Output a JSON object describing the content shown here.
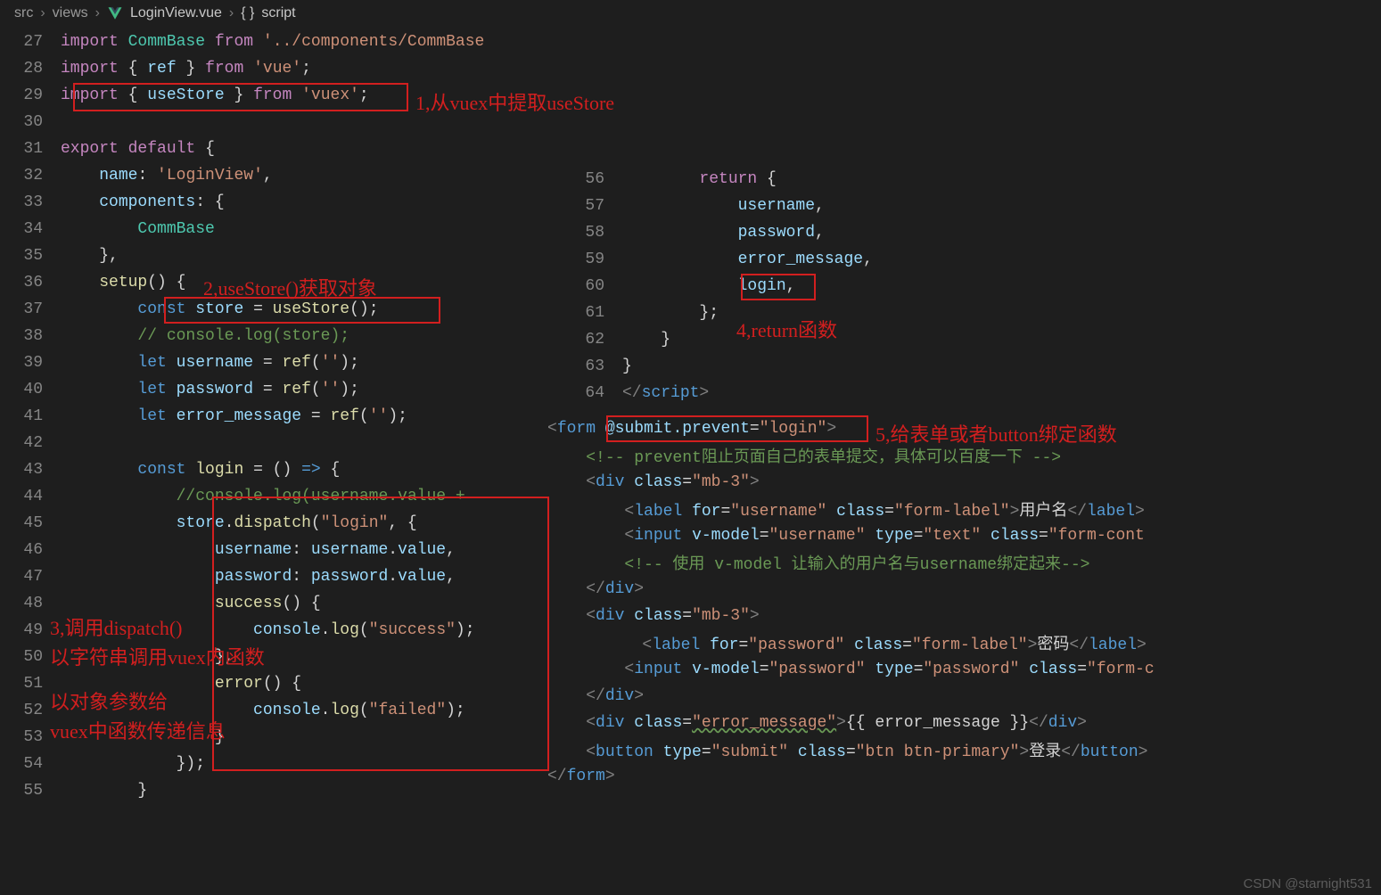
{
  "breadcrumb": {
    "p1": "src",
    "p2": "views",
    "p3": "LoginView.vue",
    "p4": "script"
  },
  "annotations": {
    "a1": "1,从vuex中提取useStore",
    "a2": "2,useStore()获取对象",
    "a3a": "3,调用dispatch()",
    "a3b": "以字符串调用vuex内函数",
    "a3c": "以对象参数给",
    "a3d": "vuex中函数传递信息",
    "a4": "4,return函数",
    "a5": "5,给表单或者button绑定函数"
  },
  "left": {
    "l27": {
      "kw": "import",
      "type": "CommBase",
      "from": "from",
      "str": "'../components/CommBase"
    },
    "l28": {
      "kw": "import",
      "brace1": "{ ",
      "var": "ref",
      "brace2": " }",
      "from": "from",
      "str": "'vue'",
      "semi": ";"
    },
    "l29": {
      "kw": "import",
      "brace1": "{ ",
      "var": "useStore",
      "brace2": " }",
      "from": "from",
      "str": "'vuex'",
      "semi": ";"
    },
    "l31": {
      "kw": "export",
      "kw2": "default",
      "brace": "{"
    },
    "l32": {
      "var": "name",
      "colon": ": ",
      "str": "'LoginView'",
      "comma": ","
    },
    "l33": {
      "var": "components",
      "colon": ": {"
    },
    "l34": {
      "type": "CommBase"
    },
    "l35": {
      "txt": "},"
    },
    "l36": {
      "fn": "setup",
      "paren": "() {"
    },
    "l37": {
      "kw": "const",
      "var": "store",
      "eq": " = ",
      "fn": "useStore",
      "end": "();"
    },
    "l38": {
      "cmt": "// console.log(store);"
    },
    "l39": {
      "kw": "let",
      "var": "username",
      "eq": " = ",
      "fn": "ref",
      "paren": "(",
      "str": "''",
      "end": ");"
    },
    "l40": {
      "kw": "let",
      "var": "password",
      "eq": " = ",
      "fn": "ref",
      "paren": "(",
      "str": "''",
      "end": ");"
    },
    "l41": {
      "kw": "let",
      "var": "error_message",
      "eq": " = ",
      "fn": "ref",
      "paren": "(",
      "str": "''",
      "end": ");"
    },
    "l43": {
      "kw": "const",
      "fn": "login",
      "eq": " = () ",
      "arrow": "=>",
      "brace": " {"
    },
    "l44": {
      "cmt": "//console.log(username.value + "
    },
    "l45": {
      "var": "store",
      "dot": ".",
      "fn": "dispatch",
      "paren": "(",
      "str": "\"login\"",
      "comma": ", {"
    },
    "l46": {
      "var": "username",
      "colon": ": ",
      "var2": "username",
      "dot": ".",
      "prop": "value",
      "comma": ","
    },
    "l47": {
      "var": "password",
      "colon": ": ",
      "var2": "password",
      "dot": ".",
      "prop": "value",
      "comma": ","
    },
    "l48": {
      "fn": "success",
      "paren": "() {"
    },
    "l49": {
      "obj": "console",
      "dot": ".",
      "fn": "log",
      "paren": "(",
      "str": "\"success\"",
      "end": ");"
    },
    "l50": {
      "txt": "},"
    },
    "l51": {
      "fn": "error",
      "paren": "() {"
    },
    "l52": {
      "obj": "console",
      "dot": ".",
      "fn": "log",
      "paren": "(",
      "str": "\"failed\"",
      "end": ");"
    },
    "l53": {
      "txt": "}"
    },
    "l54": {
      "txt": "});"
    },
    "l55": {
      "txt": "}"
    }
  },
  "right": {
    "l56": {
      "kw": "return",
      "brace": " {"
    },
    "l57": {
      "var": "username",
      "comma": ","
    },
    "l58": {
      "var": "password",
      "comma": ","
    },
    "l59": {
      "var": "error_message",
      "comma": ","
    },
    "l60": {
      "var": "login",
      "comma": ","
    },
    "l61": {
      "txt": "};"
    },
    "l62": {
      "txt": "}"
    },
    "l63": {
      "txt": "}"
    },
    "l64": {
      "open": "</",
      "tag": "script",
      "close": ">"
    }
  },
  "template": {
    "t1": {
      "open": "<",
      "tag": "form",
      "sp": " ",
      "attr": "@submit.prevent",
      "eq": "=",
      "val": "\"login\"",
      "close": ">"
    },
    "t2": {
      "cmt": "<!-- prevent阻止页面自己的表单提交，具体可以百度一下 -->"
    },
    "t3": {
      "open": "<",
      "tag": "div",
      "sp": " ",
      "attr": "class",
      "eq": "=",
      "val": "\"mb-3\"",
      "close": ">"
    },
    "t4": {
      "open": "<",
      "tag": "label",
      "sp": " ",
      "attr1": "for",
      "eq1": "=",
      "val1": "\"username\"",
      "sp2": " ",
      "attr2": "class",
      "eq2": "=",
      "val2": "\"form-label\"",
      "close": ">",
      "txt": "用户名",
      "open2": "</",
      "tag2": "label",
      "close2": ">"
    },
    "t5": {
      "open": "<",
      "tag": "input",
      "sp": " ",
      "attr1": "v-model",
      "eq1": "=",
      "val1": "\"username\"",
      "sp2": " ",
      "attr2": "type",
      "eq2": "=",
      "val2": "\"text\"",
      "sp3": " ",
      "attr3": "class",
      "eq3": "=",
      "val3": "\"form-cont"
    },
    "t6": {
      "cmt": "<!-- 使用 v-model 让输入的用户名与username绑定起来-->"
    },
    "t7": {
      "open": "</",
      "tag": "div",
      "close": ">"
    },
    "t8": {
      "open": "<",
      "tag": "div",
      "sp": " ",
      "attr": "class",
      "eq": "=",
      "val": "\"mb-3\"",
      "close": ">"
    },
    "t9": {
      "open": "<",
      "tag": "label",
      "sp": " ",
      "attr1": "for",
      "eq1": "=",
      "val1": "\"password\"",
      "sp2": " ",
      "attr2": "class",
      "eq2": "=",
      "val2": "\"form-label\"",
      "close": ">",
      "txt": "密码",
      "open2": "</",
      "tag2": "label",
      "close2": ">"
    },
    "t10": {
      "open": "<",
      "tag": "input",
      "sp": " ",
      "attr1": "v-model",
      "eq1": "=",
      "val1": "\"password\"",
      "sp2": " ",
      "attr2": "type",
      "eq2": "=",
      "val2": "\"password\"",
      "sp3": " ",
      "attr3": "class",
      "eq3": "=",
      "val3": "\"form-c"
    },
    "t11": {
      "open": "</",
      "tag": "div",
      "close": ">"
    },
    "t12": {
      "open": "<",
      "tag": "div",
      "sp": " ",
      "attr": "class",
      "eq": "=",
      "val": "\"error_message\"",
      "close": ">",
      "txt": "{{ error_message }}",
      "open2": "</",
      "tag2": "div",
      "close2": ">"
    },
    "t13": {
      "open": "<",
      "tag": "button",
      "sp": " ",
      "attr1": "type",
      "eq1": "=",
      "val1": "\"submit\"",
      "sp2": " ",
      "attr2": "class",
      "eq2": "=",
      "val2": "\"btn btn-primary\"",
      "close": ">",
      "txt": "登录",
      "open2": "</",
      "tag2": "button",
      "close2": ">"
    },
    "t14": {
      "open": "</",
      "tag": "form",
      "close": ">"
    }
  },
  "watermark": "CSDN @starnight531"
}
